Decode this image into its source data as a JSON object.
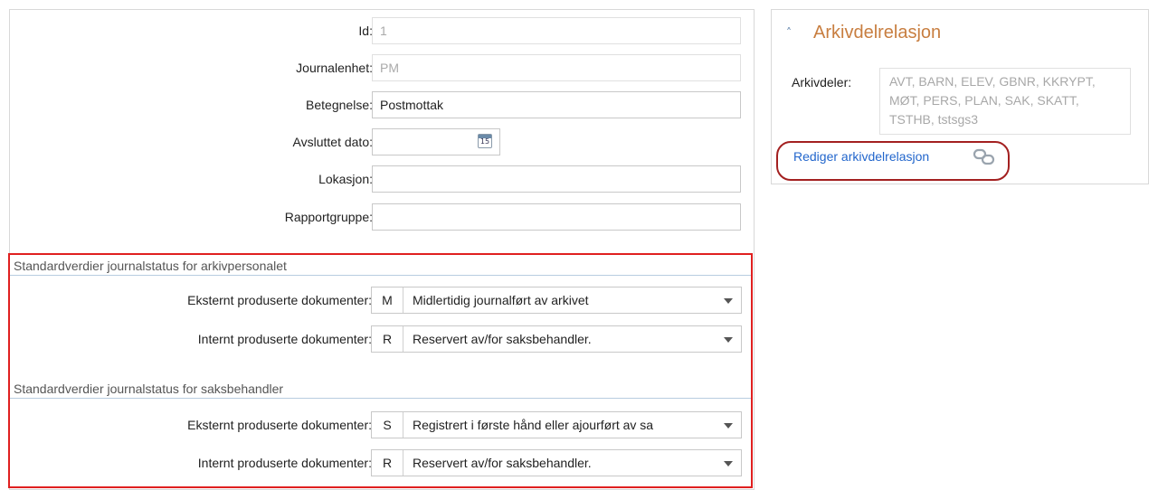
{
  "form": {
    "id": {
      "label": "Id:",
      "value": "1"
    },
    "journalenhet": {
      "label": "Journalenhet:",
      "value": "PM"
    },
    "betegnelse": {
      "label": "Betegnelse:",
      "value": "Postmottak"
    },
    "avsluttet_dato": {
      "label": "Avsluttet dato:",
      "value": "",
      "icon": "calendar-icon",
      "icon_text": "15"
    },
    "lokasjon": {
      "label": "Lokasjon:",
      "value": ""
    },
    "rapportgruppe": {
      "label": "Rapportgruppe:",
      "value": ""
    }
  },
  "arkivpersonalet": {
    "title": "Standardverdier journalstatus for arkivpersonalet",
    "eksternt": {
      "label": "Eksternt produserte dokumenter:",
      "code": "M",
      "text": "Midlertidig journalført av arkivet"
    },
    "internt": {
      "label": "Internt produserte dokumenter:",
      "code": "R",
      "text": "Reservert av/for saksbehandler."
    }
  },
  "saksbehandler": {
    "title": "Standardverdier journalstatus for saksbehandler",
    "eksternt": {
      "label": "Eksternt produserte dokumenter:",
      "code": "S",
      "text": "Registrert i første hånd eller ajourført av sa"
    },
    "internt": {
      "label": "Internt produserte dokumenter:",
      "code": "R",
      "text": "Reservert av/for saksbehandler."
    }
  },
  "arkivdelrelasjon": {
    "title": "Arkivdelrelasjon",
    "collapse_icon": "chevron-up-icon",
    "label": "Arkivdeler:",
    "values": "AVT, BARN, ELEV, GBNR, KKRYPT, MØT, PERS, PLAN, SAK, SKATT, TSTHB, tstsgs3",
    "edit_link": "Rediger arkivdelrelasjon",
    "link_icon": "chain-link-icon"
  },
  "colors": {
    "accent_title": "#c87e40",
    "link": "#2266cc",
    "highlight_red": "#e02020"
  }
}
